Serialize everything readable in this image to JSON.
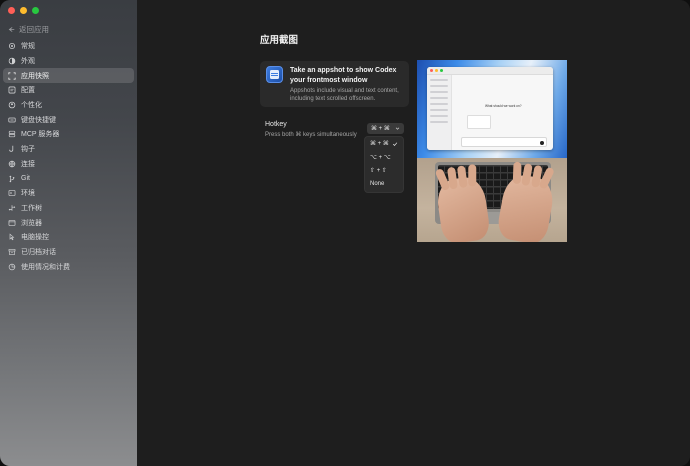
{
  "sidebar": {
    "back_label": "返回应用",
    "items": [
      {
        "label": "常规",
        "icon": "gear-icon"
      },
      {
        "label": "外观",
        "icon": "appearance-icon"
      },
      {
        "label": "应用快照",
        "icon": "appshot-icon",
        "active": true
      },
      {
        "label": "配置",
        "icon": "config-icon"
      },
      {
        "label": "个性化",
        "icon": "personalize-icon"
      },
      {
        "label": "键盘快捷键",
        "icon": "keyboard-icon"
      },
      {
        "label": "MCP 服务器",
        "icon": "server-icon"
      },
      {
        "label": "钩子",
        "icon": "hook-icon"
      },
      {
        "label": "连接",
        "icon": "globe-icon"
      },
      {
        "label": "Git",
        "icon": "git-branch-icon"
      },
      {
        "label": "环境",
        "icon": "environment-icon"
      },
      {
        "label": "工作树",
        "icon": "worktree-icon"
      },
      {
        "label": "浏览器",
        "icon": "browser-icon"
      },
      {
        "label": "电脑操控",
        "icon": "computer-control-icon"
      },
      {
        "label": "已归档对话",
        "icon": "archive-icon"
      },
      {
        "label": "使用情况和计费",
        "icon": "usage-billing-icon"
      }
    ]
  },
  "main": {
    "title": "应用截图",
    "card": {
      "title": "Take an appshot to show Codex your frontmost window",
      "description": "Appshots include visual and text content, including text scrolled offscreen."
    },
    "hotkey": {
      "label": "Hotkey",
      "description": "Press both ⌘ keys simultaneously",
      "selected": "⌘ + ⌘",
      "options": [
        {
          "label": "⌘ + ⌘",
          "checked": true
        },
        {
          "label": "⌥ + ⌥",
          "checked": false
        },
        {
          "label": "⇧ + ⇧",
          "checked": false
        },
        {
          "label": "None",
          "checked": false
        }
      ]
    },
    "preview": {
      "heading": "What should we work on?"
    }
  },
  "colors": {
    "traffic_red": "#ff5f57",
    "traffic_yellow": "#febc2e",
    "traffic_green": "#28c840",
    "accent": "#3d7ce0"
  }
}
